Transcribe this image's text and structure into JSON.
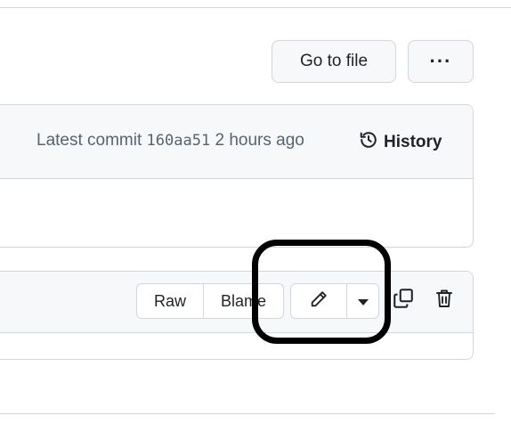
{
  "header": {
    "go_to_file_label": "Go to file",
    "more_options_label": "···"
  },
  "latest_commit": {
    "prefix": "Latest commit",
    "sha": "160aa51",
    "time": "2 hours ago",
    "history_label": "History"
  },
  "file_toolbar": {
    "raw_label": "Raw",
    "blame_label": "Blame",
    "edit_icon": "pencil-icon",
    "edit_menu_icon": "triangle-down-icon",
    "copy_icon": "copy-icon",
    "delete_icon": "trash-icon"
  },
  "colors": {
    "border": "#d0d7de",
    "header_bg": "#f6f8fa",
    "muted_text": "#59636e",
    "text": "#1f2328",
    "highlight": "#000000"
  }
}
